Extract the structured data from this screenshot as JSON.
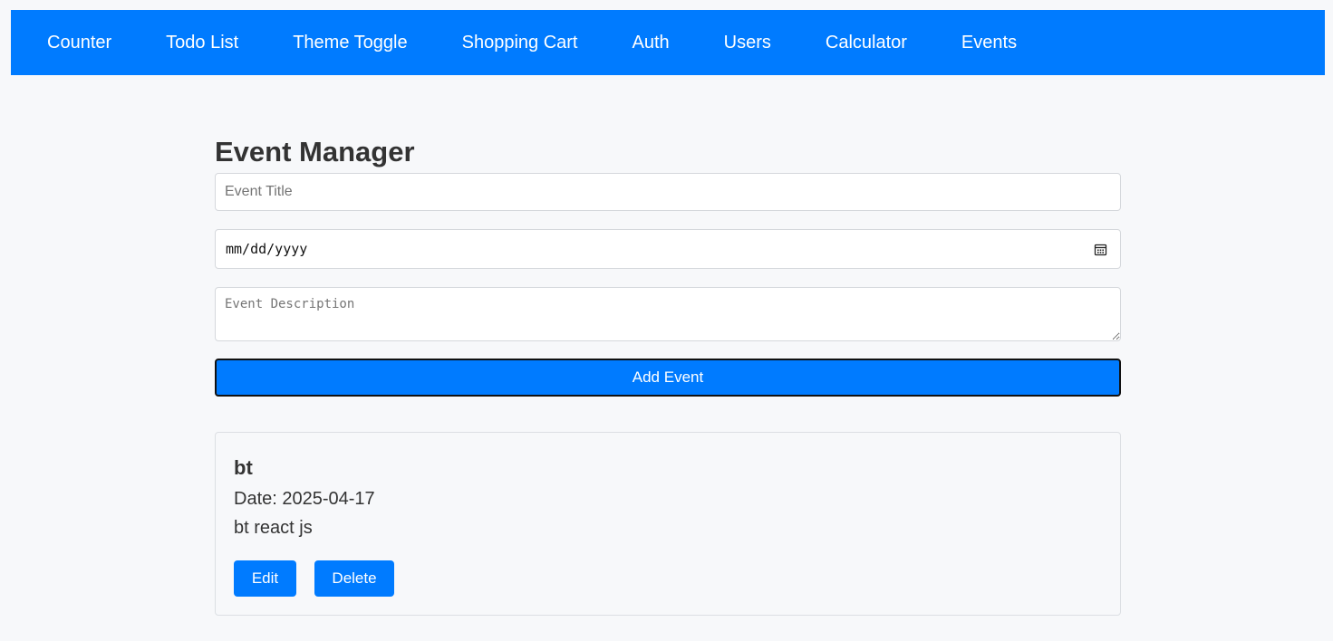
{
  "nav": {
    "items": [
      {
        "label": "Counter"
      },
      {
        "label": "Todo List"
      },
      {
        "label": "Theme Toggle"
      },
      {
        "label": "Shopping Cart"
      },
      {
        "label": "Auth"
      },
      {
        "label": "Users"
      },
      {
        "label": "Calculator"
      },
      {
        "label": "Events"
      }
    ]
  },
  "main": {
    "title": "Event Manager",
    "form": {
      "title_input": {
        "value": "",
        "placeholder": "Event Title"
      },
      "date_input": {
        "display": "mm/dd/yyyy",
        "icon": "calendar-icon"
      },
      "description_input": {
        "value": "",
        "placeholder": "Event Description"
      },
      "add_button_label": "Add Event"
    },
    "events": [
      {
        "title": "bt",
        "date_text": "Date: 2025-04-17",
        "description": "bt react js",
        "edit_label": "Edit",
        "delete_label": "Delete"
      }
    ]
  },
  "colors": {
    "primary": "#007bff",
    "background": "#f7f8fa",
    "text": "#333333"
  }
}
